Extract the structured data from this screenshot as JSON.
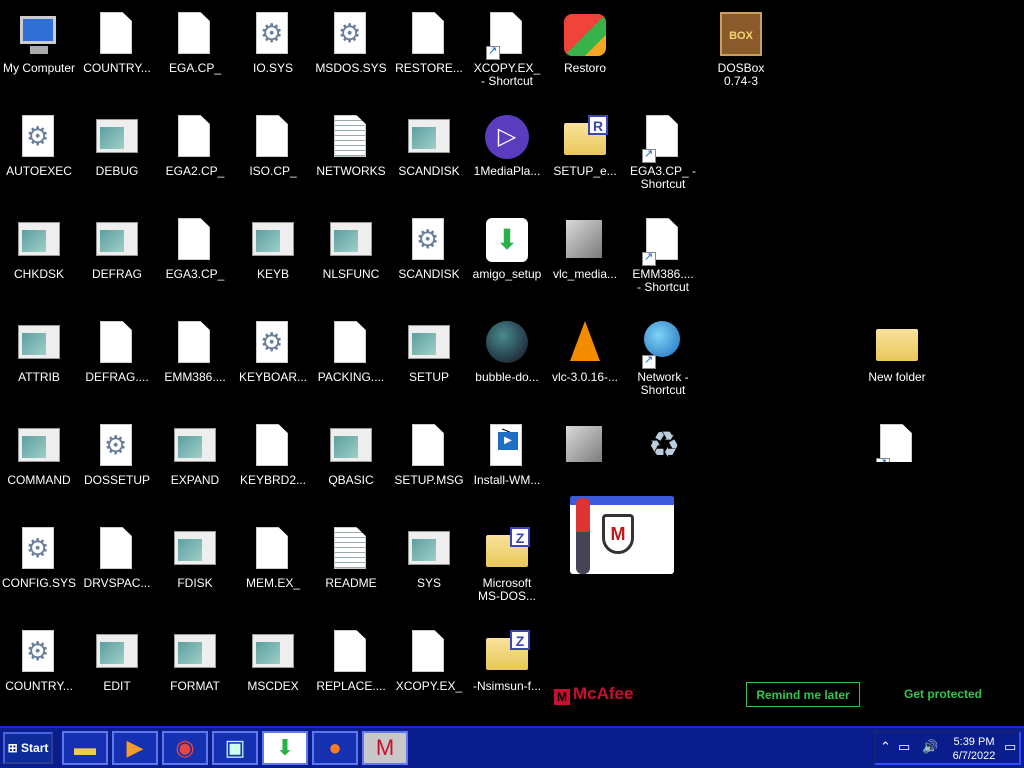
{
  "desktop": {
    "icons": [
      {
        "label": "My Computer",
        "icon": "computer-icon"
      },
      {
        "label": "COUNTRY...",
        "icon": "blank-file-icon"
      },
      {
        "label": "EGA.CP_",
        "icon": "blank-file-icon"
      },
      {
        "label": "IO.SYS",
        "icon": "gear-file-icon"
      },
      {
        "label": "MSDOS.SYS",
        "icon": "gear-file-icon"
      },
      {
        "label": "RESTORE...",
        "icon": "blank-file-icon"
      },
      {
        "label": "XCOPY.EX_\n- Shortcut",
        "icon": "blank-file-icon"
      },
      {
        "label": "Restoro",
        "icon": "restoro-icon"
      },
      {
        "label": "DOSBox\n0.74-3",
        "icon": "dosbox-icon"
      },
      {
        "label": "AUTOEXEC",
        "icon": "gear-file-icon"
      },
      {
        "label": "DEBUG",
        "icon": "program-icon"
      },
      {
        "label": "EGA2.CP_",
        "icon": "blank-file-icon"
      },
      {
        "label": "ISO.CP_",
        "icon": "blank-file-icon"
      },
      {
        "label": "NETWORKS",
        "icon": "text-file-icon"
      },
      {
        "label": "SCANDISK",
        "icon": "program-icon"
      },
      {
        "label": "1MediaPla...",
        "icon": "media-player-icon"
      },
      {
        "label": "SETUP_e...",
        "icon": "archive-icon"
      },
      {
        "label": "EGA3.CP_ -\nShortcut",
        "icon": "blank-file-icon"
      },
      {
        "label": "CHKDSK",
        "icon": "program-icon"
      },
      {
        "label": "DEFRAG",
        "icon": "program-icon"
      },
      {
        "label": "EGA3.CP_",
        "icon": "blank-file-icon"
      },
      {
        "label": "KEYB",
        "icon": "program-icon"
      },
      {
        "label": "NLSFUNC",
        "icon": "program-icon"
      },
      {
        "label": "SCANDISK",
        "icon": "gear-file-icon"
      },
      {
        "label": "amigo_setup",
        "icon": "amigo-icon"
      },
      {
        "label": "vlc_media...",
        "icon": "installer-icon"
      },
      {
        "label": "EMM386....\n- Shortcut",
        "icon": "blank-file-icon"
      },
      {
        "label": "ATTRIB",
        "icon": "program-icon"
      },
      {
        "label": "DEFRAG....",
        "icon": "blank-file-icon"
      },
      {
        "label": "EMM386....",
        "icon": "blank-file-icon"
      },
      {
        "label": "KEYBOAR...",
        "icon": "gear-file-icon"
      },
      {
        "label": "PACKING....",
        "icon": "blank-file-icon"
      },
      {
        "label": "SETUP",
        "icon": "program-icon"
      },
      {
        "label": "bubble-do...",
        "icon": "bubble-icon"
      },
      {
        "label": "vlc-3.0.16-...",
        "icon": "vlc-icon"
      },
      {
        "label": "Network -\nShortcut",
        "icon": "network-icon"
      },
      {
        "label": "New folder",
        "icon": "folder-icon"
      },
      {
        "label": "COMMAND",
        "icon": "program-icon"
      },
      {
        "label": "DOSSETUP",
        "icon": "gear-file-icon"
      },
      {
        "label": "EXPAND",
        "icon": "program-icon"
      },
      {
        "label": "KEYBRD2...",
        "icon": "blank-file-icon"
      },
      {
        "label": "QBASIC",
        "icon": "program-icon"
      },
      {
        "label": "SETUP.MSG",
        "icon": "blank-file-icon"
      },
      {
        "label": "Install-WM...",
        "icon": "powershell-icon"
      },
      {
        "label": "",
        "icon": "installer-icon"
      },
      {
        "label": "",
        "icon": "recycle-bin-icon"
      },
      {
        "label": "",
        "icon": "blank-file-icon"
      },
      {
        "label": "CONFIG.SYS",
        "icon": "gear-file-icon"
      },
      {
        "label": "DRVSPAC...",
        "icon": "blank-file-icon"
      },
      {
        "label": "FDISK",
        "icon": "program-icon"
      },
      {
        "label": "MEM.EX_",
        "icon": "blank-file-icon"
      },
      {
        "label": "README",
        "icon": "text-file-icon"
      },
      {
        "label": "SYS",
        "icon": "program-icon"
      },
      {
        "label": "Microsoft\nMS-DOS...",
        "icon": "zip-folder-icon"
      },
      {
        "label": "COUNTRY...",
        "icon": "gear-file-icon"
      },
      {
        "label": "EDIT",
        "icon": "program-icon"
      },
      {
        "label": "FORMAT",
        "icon": "program-icon"
      },
      {
        "label": "MSCDEX",
        "icon": "program-icon"
      },
      {
        "label": "REPLACE....",
        "icon": "blank-file-icon"
      },
      {
        "label": "XCOPY.EX_",
        "icon": "blank-file-icon"
      },
      {
        "label": "-Nsimsun-f...",
        "icon": "zip-folder-icon"
      }
    ]
  },
  "mcafee": {
    "brand": "McAfee",
    "remind_label": "Remind me later",
    "protect_label": "Get protected",
    "brand_color": "#c8102e",
    "button_color": "#35c24f"
  },
  "taskbar": {
    "start_label": "Start",
    "apps": [
      {
        "name": "file-explorer-icon"
      },
      {
        "name": "media-player-icon"
      },
      {
        "name": "chrome-icon"
      },
      {
        "name": "program-window-icon"
      },
      {
        "name": "amigo-icon"
      },
      {
        "name": "firefox-icon"
      },
      {
        "name": "mcafee-icon"
      }
    ],
    "clock": {
      "time": "5:39 PM",
      "date": "6/7/2022"
    }
  }
}
